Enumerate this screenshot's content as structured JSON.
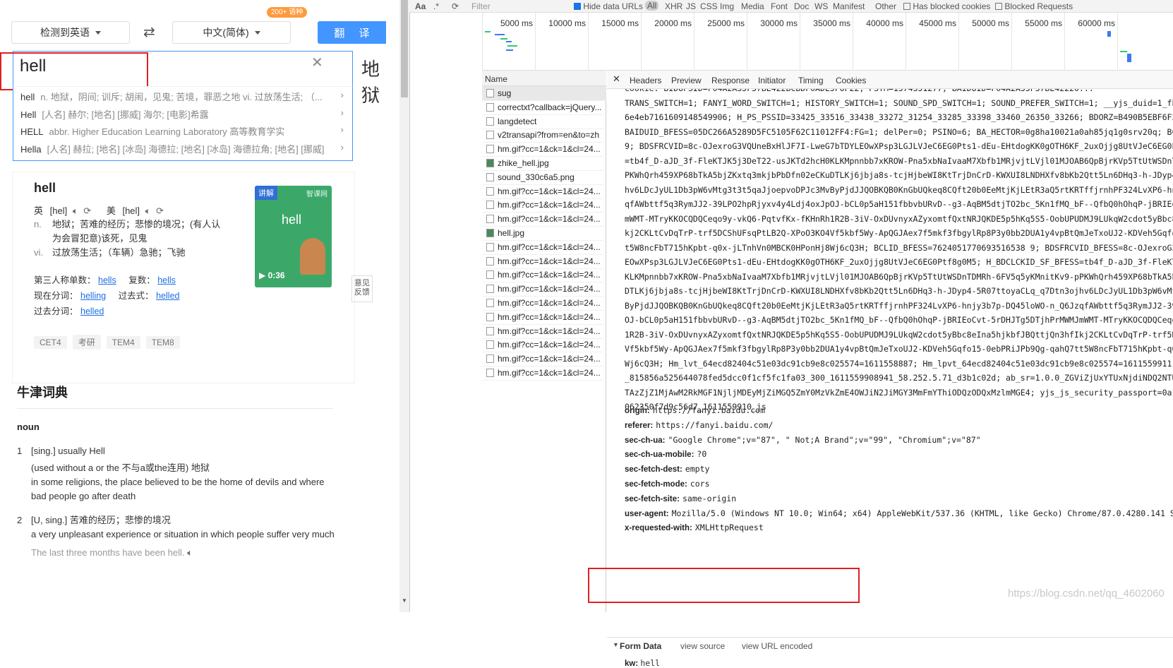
{
  "left": {
    "source_lang": "检测到英语",
    "target_lang": "中文(简体)",
    "lang_badge": "200+ 语种",
    "translate_label": "翻 译",
    "input_value": "hell",
    "result_word": "地狱",
    "suggestions": [
      {
        "word": "hell",
        "desc": "n. 地狱，阴间; 训斥; 胡闹，见鬼; 苦境，罪恶之地 vi. 过放荡生活; （..."
      },
      {
        "word": "Hell",
        "desc": "[人名] 赫尔; [地名] [挪威] 海尔; [电影]希露"
      },
      {
        "word": "HELL",
        "desc": "abbr. Higher Education Learning Laboratory 高等教育学实"
      },
      {
        "word": "Hella",
        "desc": "[人名] 赫拉; [地名] [冰岛] 海德拉; [地名] [冰岛] 海德拉角; [地名] [挪威]"
      }
    ],
    "dict": {
      "headword": "hell",
      "uk_label": "英",
      "uk_phonetic": "[hel]",
      "us_label": "美",
      "us_phonetic": "[hel]",
      "senses": [
        {
          "pos": "n.",
          "text": "地狱；苦难的经历；悲惨的境况；(有人认为会冒犯意)该死，见鬼"
        },
        {
          "pos": "vi.",
          "text": "过放荡生活；（车辆）急驰；飞驰"
        }
      ],
      "forms": [
        {
          "label": "第三人称单数：",
          "value": "hells"
        },
        {
          "label": "复数：",
          "value": "hells"
        },
        {
          "label": "现在分词：",
          "value": "helling"
        },
        {
          "label": "过去式：",
          "value": "helled"
        },
        {
          "label": "过去分词：",
          "value": "helled"
        }
      ],
      "tags": [
        "CET4",
        "考研",
        "TEM4",
        "TEM8"
      ]
    },
    "video": {
      "badge": "讲解",
      "brand": "智课网",
      "word": "hell",
      "duration": "0:36"
    },
    "feedback": "意见反馈",
    "oxford": {
      "title": "牛津词典",
      "pos": "noun",
      "entries": [
        {
          "num": "1",
          "gram": "[sing.] usually Hell",
          "cn": "(used without a or the 不与a或the连用) 地狱",
          "en": "in some religions, the place believed to be the home of devils and where bad people go after death"
        },
        {
          "num": "2",
          "gram": "[U, sing.] 苦难的经历；悲惨的境况",
          "en": "a very unpleasant experience or situation in which people suffer very much",
          "example": "The last three months have been hell."
        }
      ]
    }
  },
  "devtools": {
    "filter_placeholder": "Filter",
    "filter_types": [
      "Hide data URLs",
      "All",
      "XHR",
      "JS",
      "CSS",
      "Img",
      "Media",
      "Font",
      "Doc",
      "WS",
      "Manifest",
      "Other",
      "Has blocked cookies",
      "Blocked Requests"
    ],
    "timeline_labels": [
      "5000 ms",
      "10000 ms",
      "15000 ms",
      "20000 ms",
      "25000 ms",
      "30000 ms",
      "35000 ms",
      "40000 ms",
      "45000 ms",
      "50000 ms",
      "55000 ms",
      "60000 ms"
    ],
    "name_header": "Name",
    "requests": [
      "sug",
      "correctxt?callback=jQuery...",
      "langdetect",
      "v2transapi?from=en&to=zh",
      "hm.gif?cc=1&ck=1&cl=24...",
      "zhike_hell.jpg",
      "sound_330c6a5.png",
      "hm.gif?cc=1&ck=1&cl=24...",
      "hm.gif?cc=1&ck=1&cl=24...",
      "hm.gif?cc=1&ck=1&cl=24...",
      "hell.jpg",
      "hm.gif?cc=1&ck=1&cl=24...",
      "hm.gif?cc=1&ck=1&cl=24...",
      "hm.gif?cc=1&ck=1&cl=24...",
      "hm.gif?cc=1&ck=1&cl=24...",
      "hm.gif?cc=1&ck=1&cl=24...",
      "hm.gif?cc=1&ck=1&cl=24...",
      "hm.gif?cc=1&ck=1&cl=24...",
      "hm.gif?cc=1&ck=1&cl=24...",
      "hm.gif?cc=1&ck=1&cl=24...",
      "hm.gif?cc=1&ck=1&cl=24..."
    ],
    "detail_tabs": [
      "Headers",
      "Preview",
      "Response",
      "Initiator",
      "Timing",
      "Cookies"
    ],
    "cookie_lines": [
      "cookie: BIDUPSID=F04A2A35F37BE422BCBDF0ADE5F6F22; PSTM=1574351277; BAIDUID=F04A2A35F37BE42220...",
      "TRANS_SWITCH=1; FANYI_WORD_SWITCH=1; HISTORY_SWITCH=1; SOUND_SPD_SWITCH=1; SOUND_PREFER_SWITCH=1; __yjs_duid=1_fbb1c38",
      "6e4eb7161609148549906; H_PS_PSSID=33425_33516_33438_33272_31254_33285_33398_33460_26350_33266; BDORZ=B490B5EBF6F3CD402",
      "BAIDUID_BFESS=05DC266A5289D5FC5105F62C11012FF4:FG=1; delPer=0; PSINO=6; BA_HECTOR=0g8ha10021a0ah85jq1g0srv20q; BCLID=7",
      "9; BDSFRCVID=8c-OJexroG3VQUneBxHlJF7I-LweG7bTDYLEOwXPsp3LGJLVJeC6EG0Pts1-dEu-EHtdogKK0gOTH6KF_2uxOjjg8UtVJeC6EG0Ptf8g0",
      "=tb4f_D-aJD_3f-FleKTJK5j3DeT22-usJKTd2hcH0KLKMpnnbb7xKROW-Pna5xbNaIvaaM7Xbfb1MRjvjtLVjl01MJOAB6QpBjrKVp5TtUtWSDnTDMRh-",
      "PKWhQrh459XP68bTkA5bjZKxtq3mkjbPbDfn02eCKuDTLKj6jbja8s-tcjHjbeWI8KtTrjDnCrD-KWXUI8LNDHXfv8bKb2Qtt5Ln6DHq3-h-JDyp4-5R07",
      "hv6LDcJyUL1Db3pW6vMtg3t3t5qaJjoepvoDPJc3MvByPjdJJQOBKQB0KnGbUQkeq8CQft20b0EeMtjKjLEtR3aQ5rtKRTffjrnhPF324LvXP6-hnjy3b7",
      "qfAWbttf5q3RymJJ2-39LPO2hpRjyxv4y4Ldj4oxJpOJ-bCL0p5aH151fbbvbURvD--g3-AqBM5dtjTO2bc_5Kn1fMQ_bF--QfbQ0hOhqP-jBRIEoCvt-5",
      "mWMT-MTryKKOCQDQCeqo9y-vkQ6-PqtvfKx-fKHnRh1R2B-3iV-OxDUvnyxAZyxomtfQxtNRJQKDE5p5hKq5S5-OobUPUDMJ9LUkqW2cdot5yBbc8eIna5",
      "kj2CKLtCvDqTrP-trf5DCShUFsqPtLB2Q-XPoO3KO4Vf5kbf5Wy-ApQGJAex7f5mkf3fbgylRp8P3y0bb2DUA1y4vpBtQmJeTxoUJ2-KDVeh5Gqfo15-0e",
      "t5W8ncFbT715hKpbt-q0x-jLTnhVn0MBCK0HPonHj8Wj6cQ3H; BCLID_BFESS=7624051770693516538 9; BDSFRCVID_BFESS=8c-OJexroG3VQUneBx",
      "EOwXPsp3LGJLVJeC6EG0Pts1-dEu-EHtdogKK0gOTH6KF_2uxOjjg8UtVJeC6EG0Ptf8g0M5; H_BDCLCKID_SF_BFESS=tb4f_D-aJD_3f-FleKTJK5j3",
      "KLKMpnnbb7xKROW-Pna5xbNaIvaaM7Xbfb1MRjvjtLVjl01MJOAB6QpBjrKVp5TtUtWSDnTDMRh-6FV5q5yKMnitKv9-pPKWhQrh459XP68bTkA5bjZKxt",
      "DTLKj6jbja8s-tcjHjbeWI8KtTrjDnCrD-KWXUI8LNDHXfv8bKb2Qtt5Ln6DHq3-h-JDyp4-5R07ttoyaCLq_q7Dtn3ojhv6LDcJyUL1Db3pW6vMtg3t3t5",
      "ByPjdJJQOBKQB0KnGbUQkeq8CQft20b0EeMtjKjLEtR3aQ5rtKRTffjrnhPF324LvXP6-hnjy3b7p-DQ45loWO-n_Q6JzqfAWbttf5q3RymJJ2-39LPO2",
      "OJ-bCL0p5aH151fbbvbURvD--g3-AqBM5dtjTO2bc_5Kn1fMQ_bF--QfbQ0hOhqP-jBRIEoCvt-5rDHJTg5DTjhPrMWMJmWMT-MTryKKOCQDQCeqo9y-vk",
      "1R2B-3iV-OxDUvnyxAZyxomtfQxtNRJQKDE5p5hKq5S5-OobUPUDMJ9LUkqW2cdot5yBbc8eIna5hjkbfJBQttjQn3hfIkj2CKLtCvDqTrP-trf5DCShUF",
      "Vf5kbf5Wy-ApQGJAex7f5mkf3fbgylRp8P3y0bb2DUA1y4vpBtQmJeTxoUJ2-KDVeh5Gqfo15-0ebPRiJPb9Qg-qahQ7tt5W8ncFbT715hKpbt-q0x-jL",
      "Wj6cQ3H; Hm_lvt_64ecd82404c51e03dc91cb9e8c025574=1611558887; Hm_lpvt_64ecd82404c51e03dc91cb9e8c025574=1611559911; __y",
      "_815856a525644078fed5dcc0f1cf5fc1fa03_300_1611559908941_58.252.5.71_d3b1c02d; ab_sr=1.0.0_ZGViZjUxYTUxNjdiNDQ2NTU2NTM",
      "TAzZjZ1MjAwM2RkMGF1NjljMDEyMjZiMGQ5ZmY0MzVkZmE4OWJiN2JiMGY3MmFmYThiODQzODQxMzlmMGE4; yjs_js_security_passport=0a1352e",
      "062350f7d9c56d7_1611559910_js"
    ],
    "headers": [
      {
        "key": "origin:",
        "value": "https://fanyi.baidu.com"
      },
      {
        "key": "referer:",
        "value": "https://fanyi.baidu.com/"
      },
      {
        "key": "sec-ch-ua:",
        "value": "\"Google Chrome\";v=\"87\", \" Not;A Brand\";v=\"99\", \"Chromium\";v=\"87\""
      },
      {
        "key": "sec-ch-ua-mobile:",
        "value": "?0"
      },
      {
        "key": "sec-fetch-dest:",
        "value": "empty"
      },
      {
        "key": "sec-fetch-mode:",
        "value": "cors"
      },
      {
        "key": "sec-fetch-site:",
        "value": "same-origin"
      },
      {
        "key": "user-agent:",
        "value": "Mozilla/5.0 (Windows NT 10.0; Win64; x64) AppleWebKit/537.36 (KHTML, like Gecko) Chrome/87.0.4280.141 Safari"
      },
      {
        "key": "x-requested-with:",
        "value": "XMLHttpRequest"
      }
    ],
    "form_data": {
      "title": "Form Data",
      "view_source": "view source",
      "view_url_encoded": "view URL encoded",
      "key": "kw:",
      "value": "hell"
    },
    "watermark": "https://blog.csdn.net/qq_4602060"
  },
  "colors": {
    "accent": "#4395ff",
    "highlight_box": "#e02020",
    "link": "#1d6fe5"
  }
}
